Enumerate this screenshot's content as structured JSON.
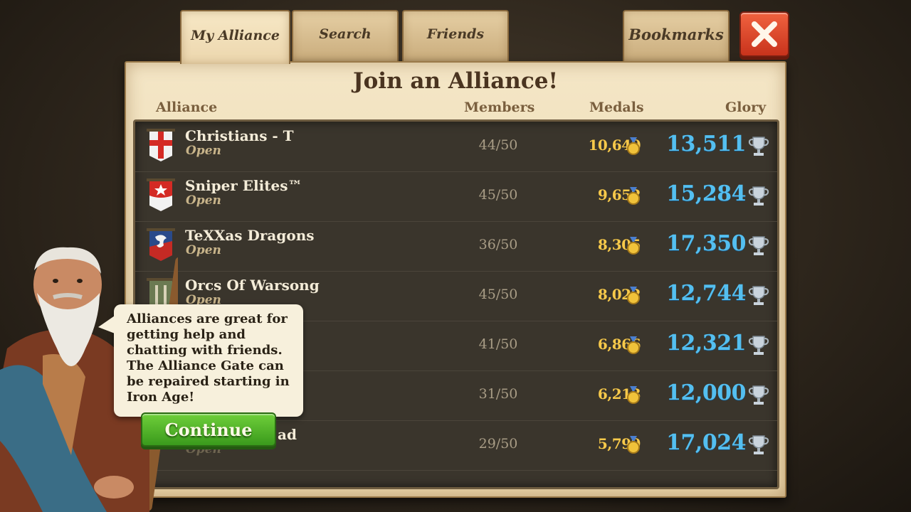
{
  "tabs": [
    {
      "label": "My Alliance",
      "active": true
    },
    {
      "label": "Search",
      "active": false
    },
    {
      "label": "Friends",
      "active": false
    },
    {
      "label": "Bookmarks",
      "active": false
    }
  ],
  "panel": {
    "title": "Join an Alliance!",
    "columns": {
      "alliance": "Alliance",
      "members": "Members",
      "medals": "Medals",
      "glory": "Glory"
    }
  },
  "alliances": [
    {
      "name": "Christians - T",
      "status": "Open",
      "members": "44/50",
      "medals": "10,640",
      "glory": "13,511",
      "banner_color": "#d42a24"
    },
    {
      "name": "Sniper Elites™",
      "status": "Open",
      "members": "45/50",
      "medals": "9,652",
      "glory": "15,284",
      "banner_color": "#d42a24"
    },
    {
      "name": "TeXXas Dragons",
      "status": "Open",
      "members": "36/50",
      "medals": "8,305",
      "glory": "17,350",
      "banner_color": "#2a4a8a"
    },
    {
      "name": "Orcs Of Warsong",
      "status": "Open",
      "members": "45/50",
      "medals": "8,022",
      "glory": "12,744",
      "banner_color": "#6b7a52"
    },
    {
      "name": "",
      "status": "",
      "members": "41/50",
      "medals": "6,866",
      "glory": "12,321",
      "banner_color": ""
    },
    {
      "name": "",
      "status": "",
      "members": "31/50",
      "medals": "6,213",
      "glory": "12,000",
      "banner_color": ""
    },
    {
      "name": "ad",
      "status": "Open",
      "members": "29/50",
      "medals": "5,799",
      "glory": "17,024",
      "banner_color": ""
    }
  ],
  "advisor": {
    "message": "Alliances are great for getting help and chatting with friends. The Alliance Gate can be repaired starting in Iron Age!",
    "continue_label": "Continue"
  },
  "icons": {
    "close": "close-icon",
    "medal": "medal-icon",
    "trophy": "trophy-icon",
    "banner": "alliance-banner-icon"
  },
  "colors": {
    "medals": "#f7c94a",
    "glory": "#54bff0",
    "close": "#d8401f",
    "continue": "#4cae26"
  }
}
